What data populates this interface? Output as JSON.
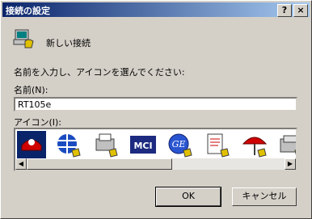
{
  "window": {
    "title": "接続の設定",
    "help_label": "?",
    "close_label": "×"
  },
  "connection": {
    "name_text": "新しい接続"
  },
  "form": {
    "prompt": "名前を入力し、アイコンを選んでください:",
    "name_label": "名前(N):",
    "name_value": "RT105e",
    "icon_label": "アイコン(I):"
  },
  "icons": [
    {
      "name": "red-phone-icon",
      "selected": true
    },
    {
      "name": "globe-phone-icon",
      "selected": false
    },
    {
      "name": "fax-phone-icon",
      "selected": false
    },
    {
      "name": "mci-icon",
      "selected": false
    },
    {
      "name": "ge-icon",
      "selected": false
    },
    {
      "name": "document-phone-icon",
      "selected": false
    },
    {
      "name": "umbrella-phone-icon",
      "selected": false
    },
    {
      "name": "phone-computer-icon",
      "selected": false
    }
  ],
  "buttons": {
    "ok_label": "OK",
    "cancel_label": "キャンセル"
  }
}
